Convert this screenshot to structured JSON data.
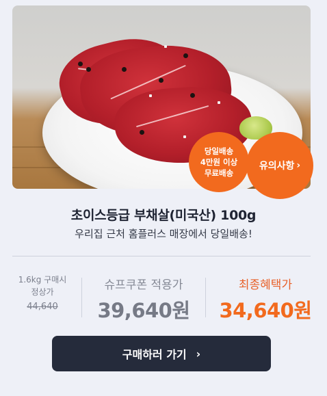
{
  "product": {
    "image_alt": "raw beef flat iron steaks on white plate with wasabi",
    "title": "초이스등급 부채살(미국산) 100g",
    "subtitle": "우리집 근처 홈플러스 매장에서 당일배송!"
  },
  "badges": {
    "delivery_lines": [
      "당일배송",
      "4만원 이상",
      "무료배송"
    ],
    "notice_label": "유의사항",
    "notice_icon": "chevron-right-icon"
  },
  "pricing": {
    "original_line1": "1.6kg 구매시",
    "original_line2": "정상가",
    "original_price": "44,640",
    "supercoupon_label": "슈프쿠폰 적용가",
    "supercoupon_price": "39,640원",
    "final_label": "최종혜택가",
    "final_price": "34,640원"
  },
  "cta": {
    "label": "구매하러 가기",
    "icon": "chevron-right-icon"
  },
  "colors": {
    "accent": "#f26a1e",
    "button": "#252b3b",
    "background": "#eef0f7"
  }
}
